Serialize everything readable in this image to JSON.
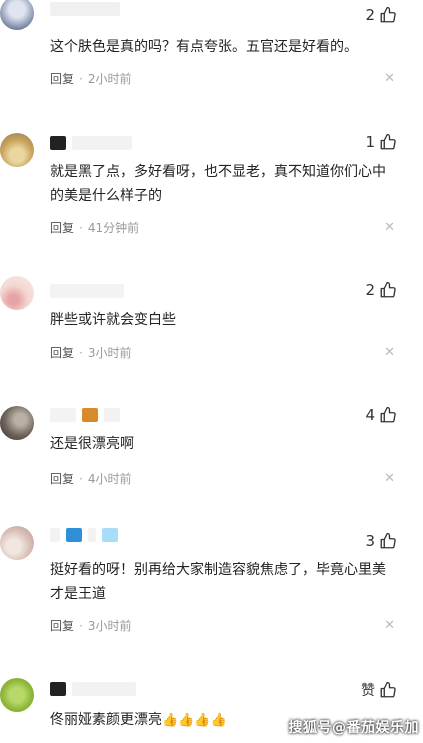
{
  "comments": [
    {
      "likes": "2",
      "text": "这个肤色是真的吗？有点夸张。五官还是好看的。",
      "reply": "回复",
      "time": "2小时前"
    },
    {
      "likes": "1",
      "text": "就是黑了点，多好看呀，也不显老，真不知道你们心中的美是什么样子的",
      "reply": "回复",
      "time": "41分钟前"
    },
    {
      "likes": "2",
      "text": "胖些或许就会变白些",
      "reply": "回复",
      "time": "3小时前"
    },
    {
      "likes": "4",
      "text": "还是很漂亮啊",
      "reply": "回复",
      "time": "4小时前"
    },
    {
      "likes": "3",
      "text": "挺好看的呀！别再给大家制造容貌焦虑了，毕竟心里美才是王道",
      "reply": "回复",
      "time": "3小时前"
    },
    {
      "likes": "赞",
      "text": "佟丽娅素颜更漂亮",
      "emoji": "👍👍👍👍"
    }
  ],
  "watermark": "搜狐号@番茄娱乐加",
  "icons": {
    "like": "thumbs-up-icon",
    "close": "close-icon"
  }
}
